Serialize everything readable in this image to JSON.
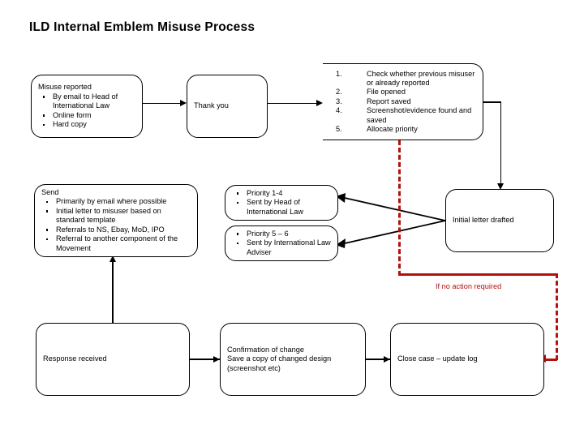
{
  "page": {
    "title": "ILD Internal Emblem Misuse Process",
    "accent_red": "#b31010",
    "line_color": "#000000",
    "background": "#ffffff"
  },
  "nodes": {
    "misuse_reported": {
      "lead": "Misuse reported",
      "bullets": [
        "By email to Head of International Law",
        "Online form",
        "Hard copy"
      ]
    },
    "thank_you": {
      "label": "Thank you"
    },
    "triage_steps": {
      "items": [
        {
          "num": "1.",
          "text": "Check whether previous misuser or already reported"
        },
        {
          "num": "2.",
          "text": "File opened"
        },
        {
          "num": "3.",
          "text": "Report saved"
        },
        {
          "num": "4.",
          "text": "Screenshot/evidence found and saved"
        },
        {
          "num": "5.",
          "text": "Allocate priority"
        }
      ]
    },
    "send": {
      "lead": "Send",
      "bullets": [
        "Primarily by email where possible",
        "Initial letter to misuser based on standard template",
        "Referrals to NS, Ebay, MoD, IPO",
        "Referral to another component of the Movement"
      ]
    },
    "priority_high": {
      "bullets": [
        "Priority 1-4",
        "Sent by Head of International Law"
      ]
    },
    "priority_low": {
      "bullets": [
        "Priority 5 – 6",
        "Sent by International Law Adviser"
      ]
    },
    "initial_letter": {
      "label": "Initial letter drafted"
    },
    "response_received": {
      "label": "Response received"
    },
    "confirmation": {
      "lines": [
        "Confirmation of change",
        "Save a copy of changed design",
        "(screenshot etc)"
      ]
    },
    "close_case": {
      "label": "Close case – update log"
    }
  },
  "annotations": {
    "no_action": "If no action required"
  }
}
